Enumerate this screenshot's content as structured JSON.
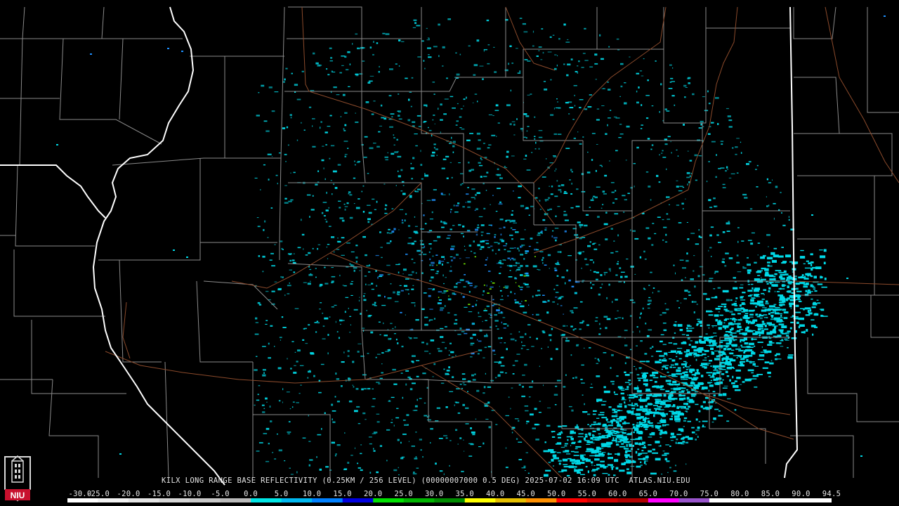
{
  "product_caption": "KILX LONG RANGE BASE REFLECTIVITY (0.25KM / 256 LEVEL) (00000007000 0.5 DEG) 2025-07-02 16:09 UTC  ATLAS.NIU.EDU",
  "logo_text": "NIU",
  "color_scale": {
    "labels": [
      "-30.0",
      "-25.0",
      "-20.0",
      "-15.0",
      "-10.0",
      "-5.0",
      "0.0",
      "5.0",
      "10.0",
      "15.0",
      "20.0",
      "25.0",
      "30.0",
      "35.0",
      "40.0",
      "45.0",
      "50.0",
      "55.0",
      "60.0",
      "65.0",
      "70.0",
      "75.0",
      "80.0",
      "85.0",
      "90.0",
      "94.5"
    ],
    "colors": [
      "#ffffff",
      "#f2f2f2",
      "#e4e4e4",
      "#d6d6d6",
      "#c8c8c8",
      "#bababa",
      "#00e5e5",
      "#00b8f0",
      "#0080ff",
      "#0000e0",
      "#00e000",
      "#00b400",
      "#008c00",
      "#ffff00",
      "#e6c000",
      "#ff9000",
      "#ff0000",
      "#d00000",
      "#b00000",
      "#ff00ff",
      "#9955cc",
      "#ffffff",
      "#ffffff",
      "#ffffff",
      "#ffffff"
    ]
  },
  "colors": {
    "background": "#000000",
    "state_border": "#ffffff",
    "county_border": "#8a8a8a",
    "highway": "#8b4a2b",
    "echo_light": "#00d8e6",
    "echo_medium": "#1e90ff",
    "echo_strong": "#7cfc00"
  },
  "radar_site": "KILX"
}
